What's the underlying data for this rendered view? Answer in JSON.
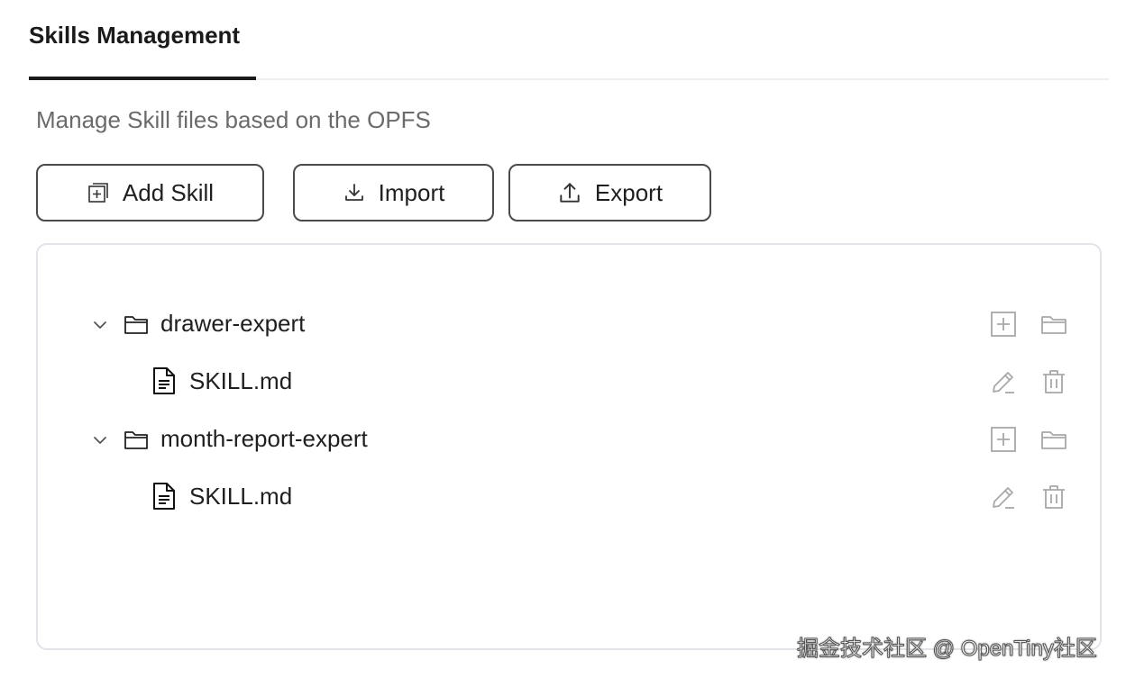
{
  "tabs": [
    {
      "label": "Skills Management",
      "active": true
    }
  ],
  "subtitle": "Manage Skill files based on the OPFS",
  "toolbar": {
    "add_label": "Add Skill",
    "import_label": "Import",
    "export_label": "Export"
  },
  "tree": [
    {
      "name": "drawer-expert",
      "expanded": true,
      "files": [
        {
          "name": "SKILL.md"
        }
      ]
    },
    {
      "name": "month-report-expert",
      "expanded": true,
      "files": [
        {
          "name": "SKILL.md"
        }
      ]
    }
  ],
  "icons": {
    "add_skill": "add-square-icon",
    "import": "download-icon",
    "export": "upload-icon",
    "expand": "chevron-down-icon",
    "folder": "folder-icon",
    "file": "file-text-icon",
    "add_file": "plus-square-icon",
    "open_folder": "folder-open-icon",
    "edit": "pencil-icon",
    "delete": "trash-icon"
  },
  "colors": {
    "text": "#1f1f1f",
    "muted": "#6b6b6b",
    "border": "#4a4a4a",
    "action_icon": "#a8a8a8",
    "active_tab": "#1a1a1a"
  },
  "watermark": "掘金技术社区 @ OpenTiny社区"
}
